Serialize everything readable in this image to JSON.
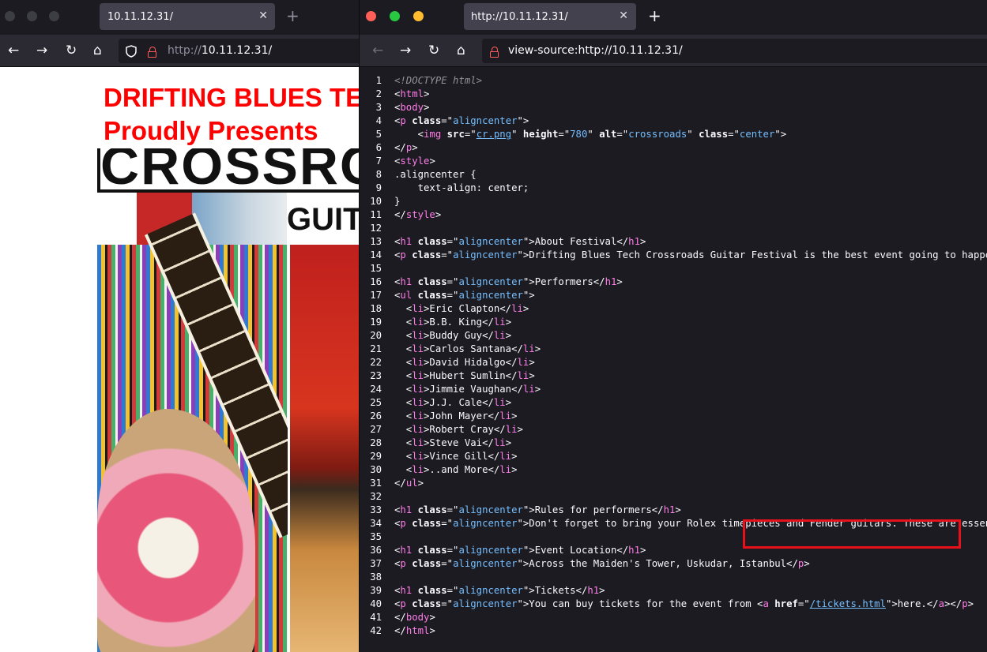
{
  "left_window": {
    "tab_title": "10.11.12.31/",
    "url_prefix": "http://",
    "url_host": "10.11.12.31/",
    "page": {
      "headline_1": "DRIFTING BLUES TE",
      "headline_2": "Proudly Presents",
      "poster_title": "CROSSRO",
      "poster_subtitle": "GUIT"
    }
  },
  "right_window": {
    "tab_title": "http://10.11.12.31/",
    "url": "view-source:http://10.11.12.31/"
  },
  "colors": {
    "headline": "#ff0000",
    "highlight_box": "#e8101a",
    "source_bg": "#1c1b22",
    "tag": "#ff7de9",
    "value": "#75bfff"
  },
  "icons": [
    "back-arrow-icon",
    "forward-arrow-icon",
    "reload-icon",
    "home-icon",
    "shield-icon",
    "lock-icon",
    "close-icon",
    "plus-icon"
  ],
  "source_lines": [
    {
      "n": "1"
    },
    {
      "n": "2"
    },
    {
      "n": "3"
    },
    {
      "n": "4"
    },
    {
      "n": "5"
    },
    {
      "n": "6"
    },
    {
      "n": "7"
    },
    {
      "n": "8"
    },
    {
      "n": "9"
    },
    {
      "n": "10"
    },
    {
      "n": "11"
    },
    {
      "n": "12"
    },
    {
      "n": "13"
    },
    {
      "n": "14"
    },
    {
      "n": "15"
    },
    {
      "n": "16"
    },
    {
      "n": "17"
    },
    {
      "n": "18"
    },
    {
      "n": "19"
    },
    {
      "n": "20"
    },
    {
      "n": "21"
    },
    {
      "n": "22"
    },
    {
      "n": "23"
    },
    {
      "n": "24"
    },
    {
      "n": "25"
    },
    {
      "n": "26"
    },
    {
      "n": "27"
    },
    {
      "n": "28"
    },
    {
      "n": "29"
    },
    {
      "n": "30"
    },
    {
      "n": "31"
    },
    {
      "n": "32"
    },
    {
      "n": "33"
    },
    {
      "n": "34"
    },
    {
      "n": "35"
    },
    {
      "n": "36"
    },
    {
      "n": "37"
    },
    {
      "n": "38"
    },
    {
      "n": "39"
    },
    {
      "n": "40"
    },
    {
      "n": "41"
    },
    {
      "n": "42"
    }
  ],
  "source": {
    "doctype": "<!DOCTYPE html>",
    "html_open": "html",
    "body_open": "body",
    "p": "p",
    "class_attr": "class",
    "aligncenter": "aligncenter",
    "img": "img",
    "src_attr": "src",
    "src_val": "cr.png",
    "height_attr": "height",
    "height_val": "780",
    "alt_attr": "alt",
    "alt_val": "crossroads",
    "center_val": "center",
    "style": "style",
    "css_selector": ".aligncenter {",
    "css_rule": "    text-align: center;",
    "css_close": "}",
    "h1": "h1",
    "about_festival": "About Festival",
    "festival_text": "Drifting Blues Tech Crossroads Guitar Festival is the best event going to happen i",
    "performers": "Performers",
    "ul": "ul",
    "li": "li",
    "performers_list": [
      "Eric Clapton",
      "B.B. King",
      "Buddy Guy",
      "Carlos Santana",
      "David Hidalgo",
      "Hubert Sumlin",
      "Jimmie Vaughan",
      "J.J. Cale",
      "John Mayer",
      "Robert Cray",
      "Steve Vai",
      "Vince Gill",
      "..and More"
    ],
    "rules": "Rules for performers",
    "rules_text": "Don't forget to bring your Rolex timepieces and Fender guitars. These are essenti",
    "event_location": "Event Location",
    "location_text": "Across the Maiden's Tower, Uskudar, Istanbul",
    "tickets": "Tickets",
    "tickets_text": "You can buy tickets for the event from ",
    "a": "a",
    "href_attr": "href",
    "href_val": "/tickets.html",
    "link_text": "here.",
    "body_close": "body",
    "html_close": "html"
  }
}
